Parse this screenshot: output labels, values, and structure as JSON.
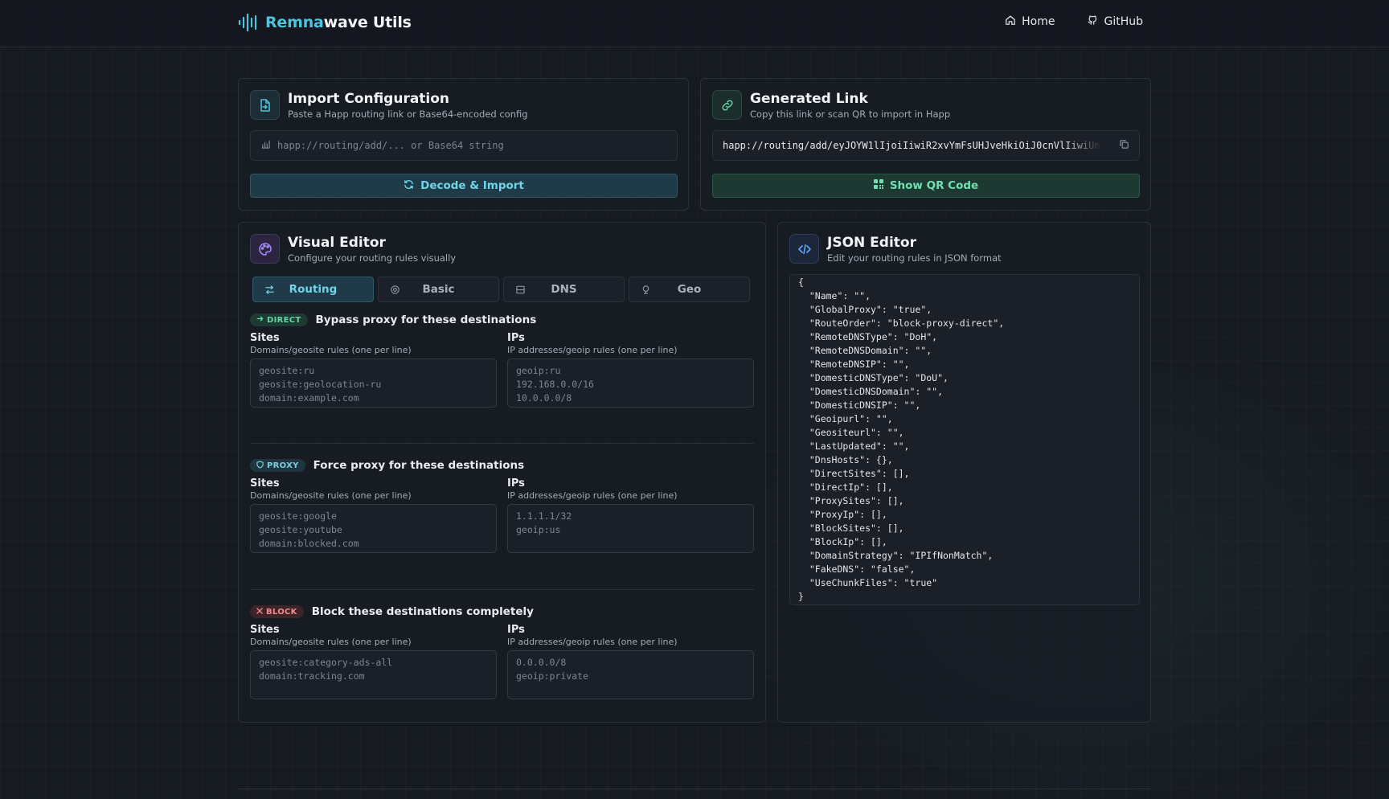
{
  "header": {
    "brand_a": "Remna",
    "brand_b": "wave Utils",
    "nav": [
      {
        "label": "Home",
        "icon": "home-icon"
      },
      {
        "label": "GitHub",
        "icon": "github-icon"
      }
    ]
  },
  "import_card": {
    "title": "Import Configuration",
    "subtitle": "Paste a Happ routing link or Base64-encoded config",
    "input_placeholder": "happ://routing/add/... or Base64 string",
    "button_label": "Decode & Import"
  },
  "link_card": {
    "title": "Generated Link",
    "subtitle": "Copy this link or scan QR to import in Happ",
    "link_value": "happ://routing/add/eyJOYW1lIjoiIiwiR2xvYmFsUHJveHkiOiJ0cnVlIiwiUm9",
    "button_label": "Show QR Code"
  },
  "visual_editor": {
    "title": "Visual Editor",
    "subtitle": "Configure your routing rules visually",
    "tabs": [
      {
        "label": "Routing",
        "active": true
      },
      {
        "label": "Basic",
        "active": false
      },
      {
        "label": "DNS",
        "active": false
      },
      {
        "label": "Geo",
        "active": false
      }
    ],
    "sections": [
      {
        "badge": "DIRECT",
        "title": "Bypass proxy for these destinations",
        "sites_label": "Sites",
        "sites_help": "Domains/geosite rules (one per line)",
        "sites_placeholder": "geosite:ru\ngeosite:geolocation-ru\ndomain:example.com",
        "ips_label": "IPs",
        "ips_help": "IP addresses/geoip rules (one per line)",
        "ips_placeholder": "geoip:ru\n192.168.0.0/16\n10.0.0.0/8"
      },
      {
        "badge": "PROXY",
        "title": "Force proxy for these destinations",
        "sites_label": "Sites",
        "sites_help": "Domains/geosite rules (one per line)",
        "sites_placeholder": "geosite:google\ngeosite:youtube\ndomain:blocked.com",
        "ips_label": "IPs",
        "ips_help": "IP addresses/geoip rules (one per line)",
        "ips_placeholder": "1.1.1.1/32\ngeoip:us"
      },
      {
        "badge": "BLOCK",
        "title": "Block these destinations completely",
        "sites_label": "Sites",
        "sites_help": "Domains/geosite rules (one per line)",
        "sites_placeholder": "geosite:category-ads-all\ndomain:tracking.com",
        "ips_label": "IPs",
        "ips_help": "IP addresses/geoip rules (one per line)",
        "ips_placeholder": "0.0.0.0/8\ngeoip:private"
      }
    ]
  },
  "json_editor": {
    "title": "JSON Editor",
    "subtitle": "Edit your routing rules in JSON format",
    "content": "{\n  \"Name\": \"\",\n  \"GlobalProxy\": \"true\",\n  \"RouteOrder\": \"block-proxy-direct\",\n  \"RemoteDNSType\": \"DoH\",\n  \"RemoteDNSDomain\": \"\",\n  \"RemoteDNSIP\": \"\",\n  \"DomesticDNSType\": \"DoU\",\n  \"DomesticDNSDomain\": \"\",\n  \"DomesticDNSIP\": \"\",\n  \"Geoipurl\": \"\",\n  \"Geositeurl\": \"\",\n  \"LastUpdated\": \"\",\n  \"DnsHosts\": {},\n  \"DirectSites\": [],\n  \"DirectIp\": [],\n  \"ProxySites\": [],\n  \"ProxyIp\": [],\n  \"BlockSites\": [],\n  \"BlockIp\": [],\n  \"DomainStrategy\": \"IPIfNonMatch\",\n  \"FakeDNS\": \"false\",\n  \"UseChunkFiles\": \"true\"\n}"
  },
  "colors": {
    "accent_teal": "#4fc3d9",
    "direct_green": "#62d6a5",
    "proxy_blue": "#7ccde3",
    "block_red": "#ef8a8f"
  }
}
